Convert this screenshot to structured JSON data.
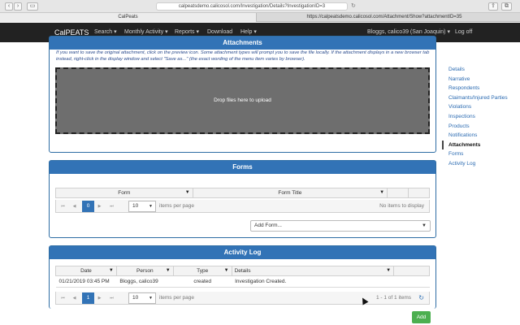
{
  "browser": {
    "url": "calpeatsdemo.calicosol.com/Investigation/Details?InvestigationID=3",
    "tabs": [
      {
        "label": "CalPeats"
      },
      {
        "label": "https://calpeatsdemo.calicosol.com/Attachment/Show?attachmentID=35"
      }
    ],
    "reload_icon": "↻"
  },
  "navbar": {
    "brand": "CalPEATS",
    "menu": [
      "Search ▾",
      "Monthly Activity ▾",
      "Reports ▾",
      "Download",
      "Help ▾"
    ],
    "user": "Bloggs, calico39 (San Joaquin) ▾",
    "logoff": "Log off"
  },
  "attachments": {
    "title": "Attachments",
    "note": "If you want to save the original attachment, click on the preview icon. Some attachment types will prompt you to save the file locally. If the attachment displays in a new browser tab instead, right-click in the display window and select \"Save as...\" (the exact wording of the menu item varies by browser).",
    "dropzone": "Drop files here to upload"
  },
  "forms": {
    "title": "Forms",
    "columns": [
      "Form",
      "Form Title"
    ],
    "pager": {
      "page": "0",
      "per_page": "10",
      "per_page_label": "items per page",
      "status": "No items to display"
    },
    "add_select": "Add Form..."
  },
  "activity": {
    "title": "Activity Log",
    "columns": [
      "Date",
      "Person",
      "Type",
      "Details"
    ],
    "rows": [
      {
        "date": "01/21/2019 03:45 PM",
        "person": "Bloggs, calico39",
        "type": "created",
        "details": "Investigation Created."
      }
    ],
    "pager": {
      "page": "1",
      "per_page": "10",
      "per_page_label": "items per page",
      "status": "1 - 1 of 1 items"
    },
    "add_button": "Add"
  },
  "sidenav": {
    "items": [
      "Details",
      "Narrative",
      "Respondents",
      "Claimants/Injured Parties",
      "Violations",
      "Inspections",
      "Products",
      "Notifications",
      "Attachments",
      "Forms",
      "Activity Log"
    ],
    "active": "Attachments"
  },
  "icons": {
    "filter": "▼",
    "first": "⏮",
    "prev": "◀",
    "next": "▶",
    "last": "⏭",
    "refresh": "↻",
    "caret": "▼"
  }
}
